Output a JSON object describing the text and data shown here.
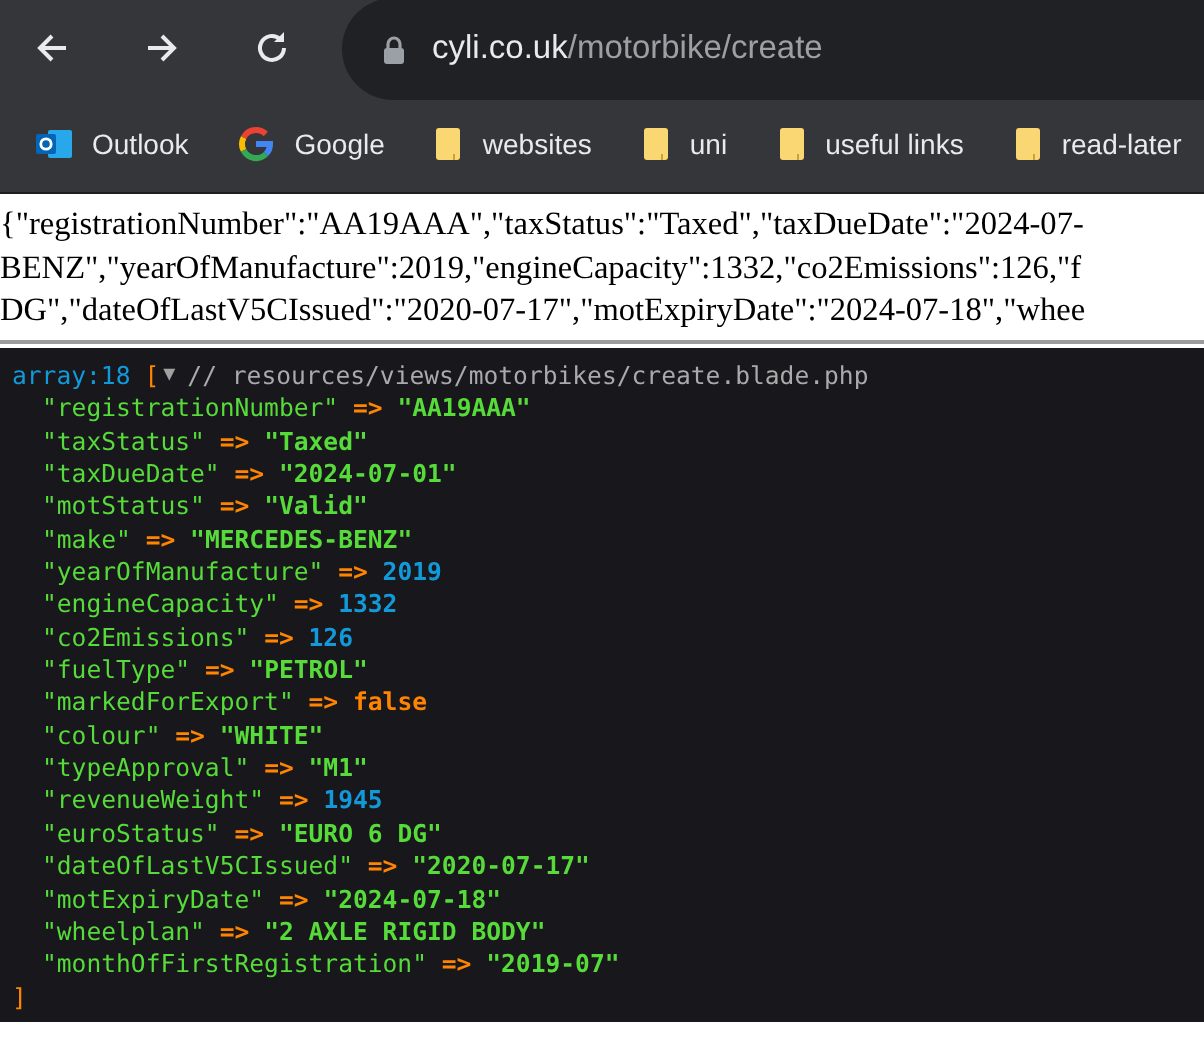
{
  "browser": {
    "url_host": "cyli.co.uk",
    "url_path": "/motorbike/create",
    "bookmarks": [
      {
        "label": "Outlook",
        "kind": "outlook"
      },
      {
        "label": "Google",
        "kind": "google"
      },
      {
        "label": "websites",
        "kind": "folder"
      },
      {
        "label": "uni",
        "kind": "folder"
      },
      {
        "label": "useful links",
        "kind": "folder"
      },
      {
        "label": "read-later",
        "kind": "folder"
      }
    ]
  },
  "json_output": [
    "{\"registrationNumber\":\"AA19AAA\",\"taxStatus\":\"Taxed\",\"taxDueDate\":\"2024-07-",
    "BENZ\",\"yearOfManufacture\":2019,\"engineCapacity\":1332,\"co2Emissions\":126,\"f",
    "DG\",\"dateOfLastV5CIssued\":\"2020-07-17\",\"motExpiryDate\":\"2024-07-18\",\"whee"
  ],
  "dump": {
    "type_label": "array:18",
    "open_bracket": "[",
    "toggle": "▼",
    "comment": "// resources/views/motorbikes/create.blade.php",
    "close_bracket": "]",
    "entries": [
      {
        "key": "\"registrationNumber\"",
        "arrow": "=>",
        "value": "\"AA19AAA\"",
        "kind": "string"
      },
      {
        "key": "\"taxStatus\"",
        "arrow": "=>",
        "value": "\"Taxed\"",
        "kind": "string"
      },
      {
        "key": "\"taxDueDate\"",
        "arrow": "=>",
        "value": "\"2024-07-01\"",
        "kind": "string"
      },
      {
        "key": "\"motStatus\"",
        "arrow": "=>",
        "value": "\"Valid\"",
        "kind": "string"
      },
      {
        "key": "\"make\"",
        "arrow": "=>",
        "value": "\"MERCEDES-BENZ\"",
        "kind": "string"
      },
      {
        "key": "\"yearOfManufacture\"",
        "arrow": "=>",
        "value": "2019",
        "kind": "number"
      },
      {
        "key": "\"engineCapacity\"",
        "arrow": "=>",
        "value": "1332",
        "kind": "number"
      },
      {
        "key": "\"co2Emissions\"",
        "arrow": "=>",
        "value": "126",
        "kind": "number"
      },
      {
        "key": "\"fuelType\"",
        "arrow": "=>",
        "value": "\"PETROL\"",
        "kind": "string"
      },
      {
        "key": "\"markedForExport\"",
        "arrow": "=>",
        "value": "false",
        "kind": "boolean"
      },
      {
        "key": "\"colour\"",
        "arrow": "=>",
        "value": "\"WHITE\"",
        "kind": "string"
      },
      {
        "key": "\"typeApproval\"",
        "arrow": "=>",
        "value": "\"M1\"",
        "kind": "string"
      },
      {
        "key": "\"revenueWeight\"",
        "arrow": "=>",
        "value": "1945",
        "kind": "number"
      },
      {
        "key": "\"euroStatus\"",
        "arrow": "=>",
        "value": "\"EURO 6 DG\"",
        "kind": "string"
      },
      {
        "key": "\"dateOfLastV5CIssued\"",
        "arrow": "=>",
        "value": "\"2020-07-17\"",
        "kind": "string"
      },
      {
        "key": "\"motExpiryDate\"",
        "arrow": "=>",
        "value": "\"2024-07-18\"",
        "kind": "string"
      },
      {
        "key": "\"wheelplan\"",
        "arrow": "=>",
        "value": "\"2 AXLE RIGID BODY\"",
        "kind": "string"
      },
      {
        "key": "\"monthOfFirstRegistration\"",
        "arrow": "=>",
        "value": "\"2019-07\"",
        "kind": "string"
      }
    ]
  }
}
